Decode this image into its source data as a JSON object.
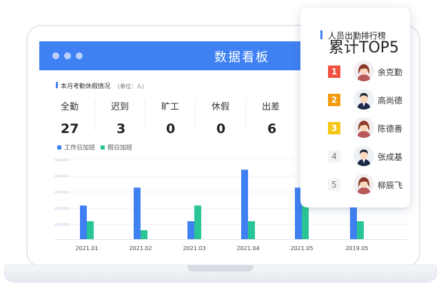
{
  "window": {
    "title": "数据看板"
  },
  "stats_section": {
    "title": "本月考勤休假情况",
    "unit": "（单位：人）",
    "items": [
      {
        "label": "全勤",
        "value": "27"
      },
      {
        "label": "迟到",
        "value": "3"
      },
      {
        "label": "旷工",
        "value": "0"
      },
      {
        "label": "休假",
        "value": "0"
      },
      {
        "label": "出差",
        "value": "6"
      }
    ]
  },
  "chart_data": {
    "type": "bar",
    "categories": [
      "2021.01",
      "2021.02",
      "2021.03",
      "2021.04",
      "2021.05",
      "2019.05"
    ],
    "series": [
      {
        "name": "工作日加班",
        "color": "#3f81f3",
        "values": [
          15,
          23,
          8,
          31,
          23,
          17
        ]
      },
      {
        "name": "假日加班",
        "color": "#29c596",
        "values": [
          8,
          4,
          15,
          8,
          15,
          8
        ]
      }
    ],
    "ylim": [
      0,
      36
    ],
    "grid": true,
    "legend_position": "top-left"
  },
  "ranking": {
    "title": "人员出勤排行榜",
    "subtitle": "累计TOP5",
    "items": [
      {
        "rank": "1",
        "name": "余克勤",
        "badge_color": "#f0503c",
        "avatar": "female"
      },
      {
        "rank": "2",
        "name": "高尚德",
        "badge_color": "#f39c12",
        "avatar": "male"
      },
      {
        "rank": "3",
        "name": "陈德善",
        "badge_color": "#f5c518",
        "avatar": "female"
      },
      {
        "rank": "4",
        "name": "张成基",
        "badge_color": "#f2f3f5",
        "avatar": "male"
      },
      {
        "rank": "5",
        "name": "柳辰飞",
        "badge_color": "#f2f3f5",
        "avatar": "female"
      }
    ]
  }
}
